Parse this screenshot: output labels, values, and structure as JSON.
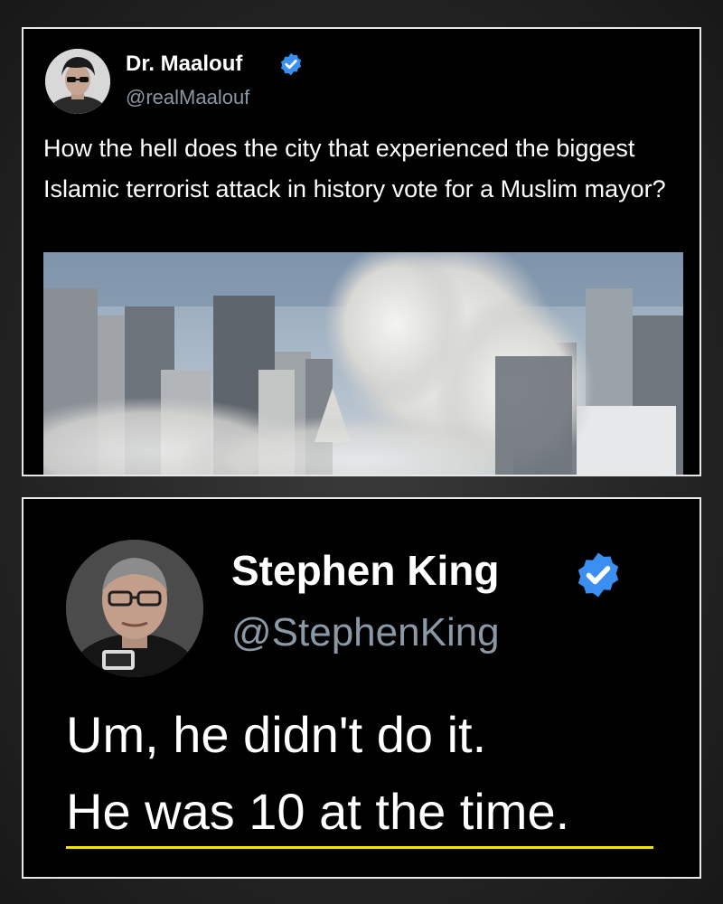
{
  "tweet1": {
    "name": "Dr. Maalouf",
    "handle": "@realMaalouf",
    "text": "How the hell does the city that experienced the biggest Islamic terrorist attack in history vote for a Muslim mayor?"
  },
  "tweet2": {
    "name": "Stephen King",
    "handle": "@StephenKing",
    "line1": "Um, he didn't do it.",
    "line2": "He was 10 at the time."
  },
  "colors": {
    "verified": "#3b8ff0",
    "handle": "#8b98a5",
    "underline": "#f2e300"
  },
  "icons": [
    "verified-badge-icon"
  ]
}
